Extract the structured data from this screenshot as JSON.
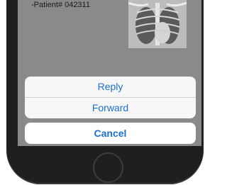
{
  "message": {
    "patient_line": "-Patient# 042311",
    "attachment_icon": "chest-xray-image"
  },
  "action_sheet": {
    "reply_label": "Reply",
    "forward_label": "Forward",
    "cancel_label": "Cancel"
  },
  "colors": {
    "accent": "#1c6fd6",
    "dim_overlay": "#8a8a8a",
    "device": "#1f1f21",
    "sheet": "#f7f7f7"
  }
}
